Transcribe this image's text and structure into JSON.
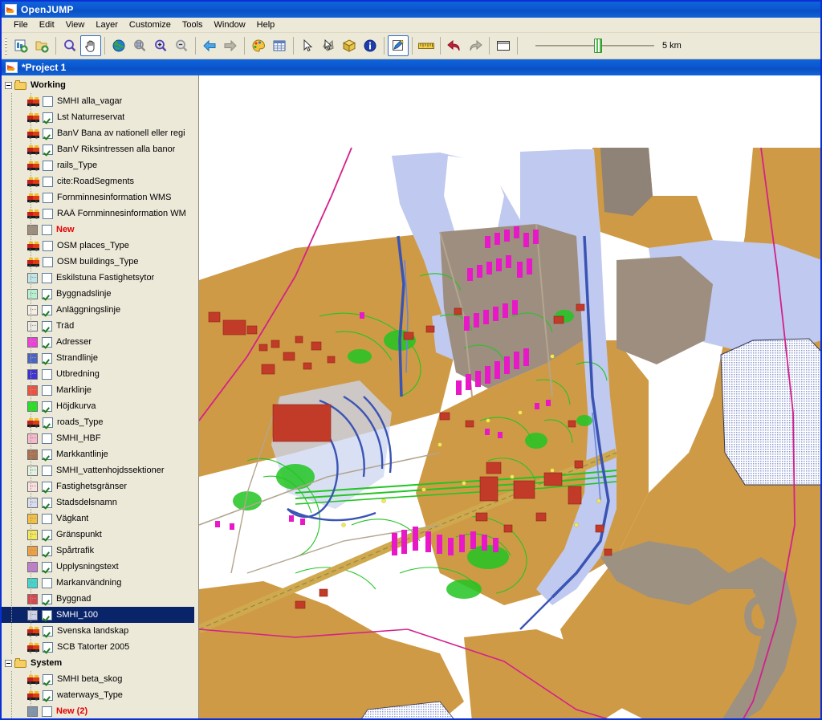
{
  "window": {
    "app_title": "OpenJUMP",
    "logo_icon": "openjump-logo-icon"
  },
  "menubar": {
    "items": [
      {
        "label": "File"
      },
      {
        "label": "Edit"
      },
      {
        "label": "View"
      },
      {
        "label": "Layer"
      },
      {
        "label": "Customize"
      },
      {
        "label": "Tools"
      },
      {
        "label": "Window"
      },
      {
        "label": "Help"
      }
    ]
  },
  "toolbar": {
    "buttons": [
      {
        "name": "new-task-icon",
        "pressed": false
      },
      {
        "name": "open-folder-icon",
        "pressed": false
      },
      {
        "name": "zoom-icon",
        "pressed": false
      },
      {
        "name": "pan-hand-icon",
        "pressed": true
      },
      {
        "name": "zoom-full-extent-globe-icon",
        "pressed": false
      },
      {
        "name": "zoom-to-selected-icon",
        "pressed": false
      },
      {
        "name": "zoom-in-icon",
        "pressed": false
      },
      {
        "name": "zoom-out-icon",
        "pressed": false
      },
      {
        "name": "previous-extent-arrow-icon",
        "pressed": false
      },
      {
        "name": "next-extent-arrow-icon",
        "pressed": false
      },
      {
        "name": "layer-styles-palette-icon",
        "pressed": false
      },
      {
        "name": "attribute-table-grid-icon",
        "pressed": false
      },
      {
        "name": "select-feature-cursor-icon",
        "pressed": false
      },
      {
        "name": "select-parts-icon",
        "pressed": false
      },
      {
        "name": "select-features-box-icon",
        "pressed": false
      },
      {
        "name": "feature-info-icon",
        "pressed": false
      },
      {
        "name": "edit-geometry-icon",
        "pressed": true
      },
      {
        "name": "measure-ruler-icon",
        "pressed": false
      },
      {
        "name": "undo-arrow-icon",
        "pressed": false
      },
      {
        "name": "redo-arrow-icon",
        "pressed": false
      },
      {
        "name": "new-window-icon",
        "pressed": false
      }
    ],
    "scale": {
      "label": "5 km",
      "slider_value": 53
    }
  },
  "project": {
    "title": "*Project 1",
    "logo_icon": "openjump-logo-icon"
  },
  "layer_tree": {
    "groups": [
      {
        "name": "Working",
        "expanded": true,
        "layers": [
          {
            "label": "SMHI alla_vagar",
            "checked": false,
            "icon": "raster",
            "color": "",
            "selected": false,
            "new": false
          },
          {
            "label": "Lst Naturreservat",
            "checked": true,
            "icon": "raster",
            "color": "",
            "selected": false,
            "new": false
          },
          {
            "label": "BanV Bana av nationell eller regi",
            "checked": true,
            "icon": "raster",
            "color": "",
            "selected": false,
            "new": false
          },
          {
            "label": "BanV Riksintressen alla banor",
            "checked": true,
            "icon": "raster",
            "color": "",
            "selected": false,
            "new": false
          },
          {
            "label": "rails_Type",
            "checked": false,
            "icon": "raster",
            "color": "",
            "selected": false,
            "new": false
          },
          {
            "label": "cite:RoadSegments",
            "checked": false,
            "icon": "raster",
            "color": "",
            "selected": false,
            "new": false
          },
          {
            "label": "Fornminnesinformation WMS",
            "checked": false,
            "icon": "raster",
            "color": "",
            "selected": false,
            "new": false
          },
          {
            "label": "RAÄ Fornminnesinformation WM",
            "checked": false,
            "icon": "raster",
            "color": "",
            "selected": false,
            "new": false
          },
          {
            "label": "New",
            "checked": false,
            "icon": "swatch",
            "color": "#9c8d7d",
            "selected": false,
            "new": true
          },
          {
            "label": "OSM places_Type",
            "checked": false,
            "icon": "raster",
            "color": "",
            "selected": false,
            "new": false
          },
          {
            "label": "OSM buildings_Type",
            "checked": false,
            "icon": "raster",
            "color": "",
            "selected": false,
            "new": false
          },
          {
            "label": "Eskilstuna Fastighetsytor",
            "checked": false,
            "icon": "swatch",
            "color": "#bfe5e8",
            "selected": false,
            "new": false
          },
          {
            "label": "Byggnadslinje",
            "checked": true,
            "icon": "swatch",
            "color": "#b6f0d2",
            "selected": false,
            "new": false
          },
          {
            "label": "Anläggningslinje",
            "checked": true,
            "icon": "swatch",
            "color": "#f4eee6",
            "selected": false,
            "new": false
          },
          {
            "label": "Träd",
            "checked": true,
            "icon": "swatch",
            "color": "#eceae4",
            "selected": false,
            "new": false
          },
          {
            "label": "Adresser",
            "checked": true,
            "icon": "swatch",
            "color": "#f33ce0",
            "selected": false,
            "new": false
          },
          {
            "label": "Strandlinje",
            "checked": true,
            "icon": "swatch",
            "color": "#4a63c8",
            "selected": false,
            "new": false
          },
          {
            "label": "Utbredning",
            "checked": false,
            "icon": "swatch",
            "color": "#3f33d8",
            "selected": false,
            "new": false
          },
          {
            "label": "Marklinje",
            "checked": false,
            "icon": "swatch",
            "color": "#f05040",
            "selected": false,
            "new": false
          },
          {
            "label": "Höjdkurva",
            "checked": true,
            "icon": "swatch",
            "color": "#22e322",
            "selected": false,
            "new": false
          },
          {
            "label": "roads_Type",
            "checked": true,
            "icon": "raster",
            "color": "",
            "selected": false,
            "new": false
          },
          {
            "label": "SMHI_HBF",
            "checked": false,
            "icon": "swatch",
            "color": "#f6b8cd",
            "selected": false,
            "new": false
          },
          {
            "label": "Markkantlinje",
            "checked": true,
            "icon": "swatch",
            "color": "#a9714f",
            "selected": false,
            "new": false
          },
          {
            "label": "SMHI_vattenhojdssektioner",
            "checked": false,
            "icon": "swatch",
            "color": "#e2f2e2",
            "selected": false,
            "new": false
          },
          {
            "label": "Fastighetsgränser",
            "checked": true,
            "icon": "swatch",
            "color": "#fadfe0",
            "selected": false,
            "new": false
          },
          {
            "label": "Stadsdelsnamn",
            "checked": true,
            "icon": "swatch",
            "color": "#d6dcf2",
            "selected": false,
            "new": false
          },
          {
            "label": "Vägkant",
            "checked": false,
            "icon": "swatch",
            "color": "#f5c040",
            "selected": false,
            "new": false
          },
          {
            "label": "Gränspunkt",
            "checked": true,
            "icon": "swatch",
            "color": "#f2e85a",
            "selected": false,
            "new": false
          },
          {
            "label": "Spårtrafik",
            "checked": true,
            "icon": "swatch",
            "color": "#f0a040",
            "selected": false,
            "new": false
          },
          {
            "label": "Upplysningstext",
            "checked": true,
            "icon": "swatch",
            "color": "#c07cd0",
            "selected": false,
            "new": false
          },
          {
            "label": "Markanvändning",
            "checked": false,
            "icon": "swatch",
            "color": "#3fd8d0",
            "selected": false,
            "new": false
          },
          {
            "label": "Byggnad",
            "checked": true,
            "icon": "swatch",
            "color": "#d9484f",
            "selected": false,
            "new": false
          },
          {
            "label": "SMHI_100",
            "checked": true,
            "icon": "swatch",
            "color": "#ccd2ec",
            "selected": true,
            "new": false
          },
          {
            "label": "Svenska landskap",
            "checked": true,
            "icon": "raster",
            "color": "",
            "selected": false,
            "new": false
          },
          {
            "label": "SCB Tatorter 2005",
            "checked": true,
            "icon": "raster",
            "color": "",
            "selected": false,
            "new": false
          }
        ]
      },
      {
        "name": "System",
        "expanded": true,
        "layers": [
          {
            "label": "SMHI beta_skog",
            "checked": true,
            "icon": "raster",
            "color": "",
            "selected": false,
            "new": false
          },
          {
            "label": "waterways_Type",
            "checked": true,
            "icon": "raster",
            "color": "",
            "selected": false,
            "new": false
          },
          {
            "label": "New (2)",
            "checked": false,
            "icon": "swatch",
            "color": "#7f93ad",
            "selected": false,
            "new": true
          }
        ]
      }
    ]
  },
  "map": {
    "name": "map-canvas",
    "colors": {
      "land_tan": "#cf9a45",
      "water_lightblue": "#c0c9ef",
      "grey_urban": "#9d8e80",
      "white_bg": "#ffffff",
      "green_contour": "#22c522",
      "building_red": "#c23a28",
      "magenta_address": "#e818c8",
      "river_blue": "#3a54b4",
      "rail_line": "#b4a88c",
      "pink_route": "#d4208c",
      "stipple_blue": "#9aa6d8"
    }
  }
}
